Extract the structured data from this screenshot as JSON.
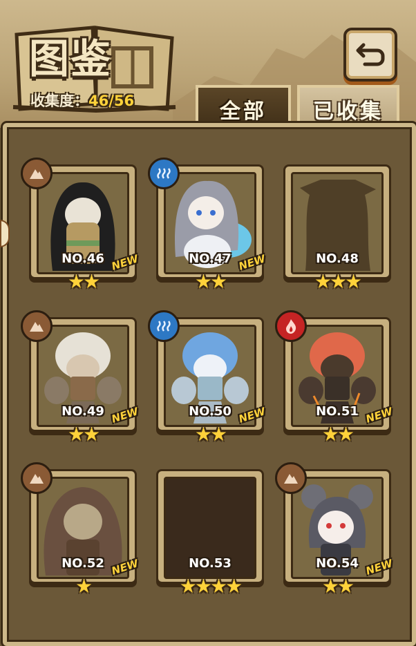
{
  "header": {
    "title": "图鉴",
    "collection_label": "收集度：",
    "collection_value": "46/56"
  },
  "tabs": [
    {
      "label": "全部",
      "active": true
    },
    {
      "label": "已收集",
      "active": false
    }
  ],
  "colors": {
    "accent_yellow": "#ffd23a",
    "panel_brown": "#6b5838",
    "earth": "#8a5a35",
    "water": "#2d78c4",
    "fire": "#c52424"
  },
  "cards": [
    {
      "no": "NO.46",
      "stars": "★★",
      "star_count": 2,
      "new": "NEW",
      "element": "earth-icon",
      "state": "collected"
    },
    {
      "no": "NO.47",
      "stars": "★★",
      "star_count": 2,
      "new": "NEW",
      "element": "water-icon",
      "state": "collected"
    },
    {
      "no": "NO.48",
      "stars": "★★★",
      "star_count": 3,
      "new": "",
      "element": "",
      "state": "silhouette"
    },
    {
      "no": "NO.49",
      "stars": "★★",
      "star_count": 2,
      "new": "NEW",
      "element": "earth-icon",
      "state": "collected"
    },
    {
      "no": "NO.50",
      "stars": "★★",
      "star_count": 2,
      "new": "NEW",
      "element": "water-icon",
      "state": "collected"
    },
    {
      "no": "NO.51",
      "stars": "★★",
      "star_count": 2,
      "new": "NEW",
      "element": "fire-icon",
      "state": "collected"
    },
    {
      "no": "NO.52",
      "stars": "★",
      "star_count": 1,
      "new": "NEW",
      "element": "earth-icon",
      "state": "collected"
    },
    {
      "no": "NO.53",
      "stars": "★★★★",
      "star_count": 4,
      "new": "",
      "element": "",
      "state": "locked"
    },
    {
      "no": "NO.54",
      "stars": "★★",
      "star_count": 2,
      "new": "NEW",
      "element": "earth-icon",
      "state": "collected"
    }
  ]
}
